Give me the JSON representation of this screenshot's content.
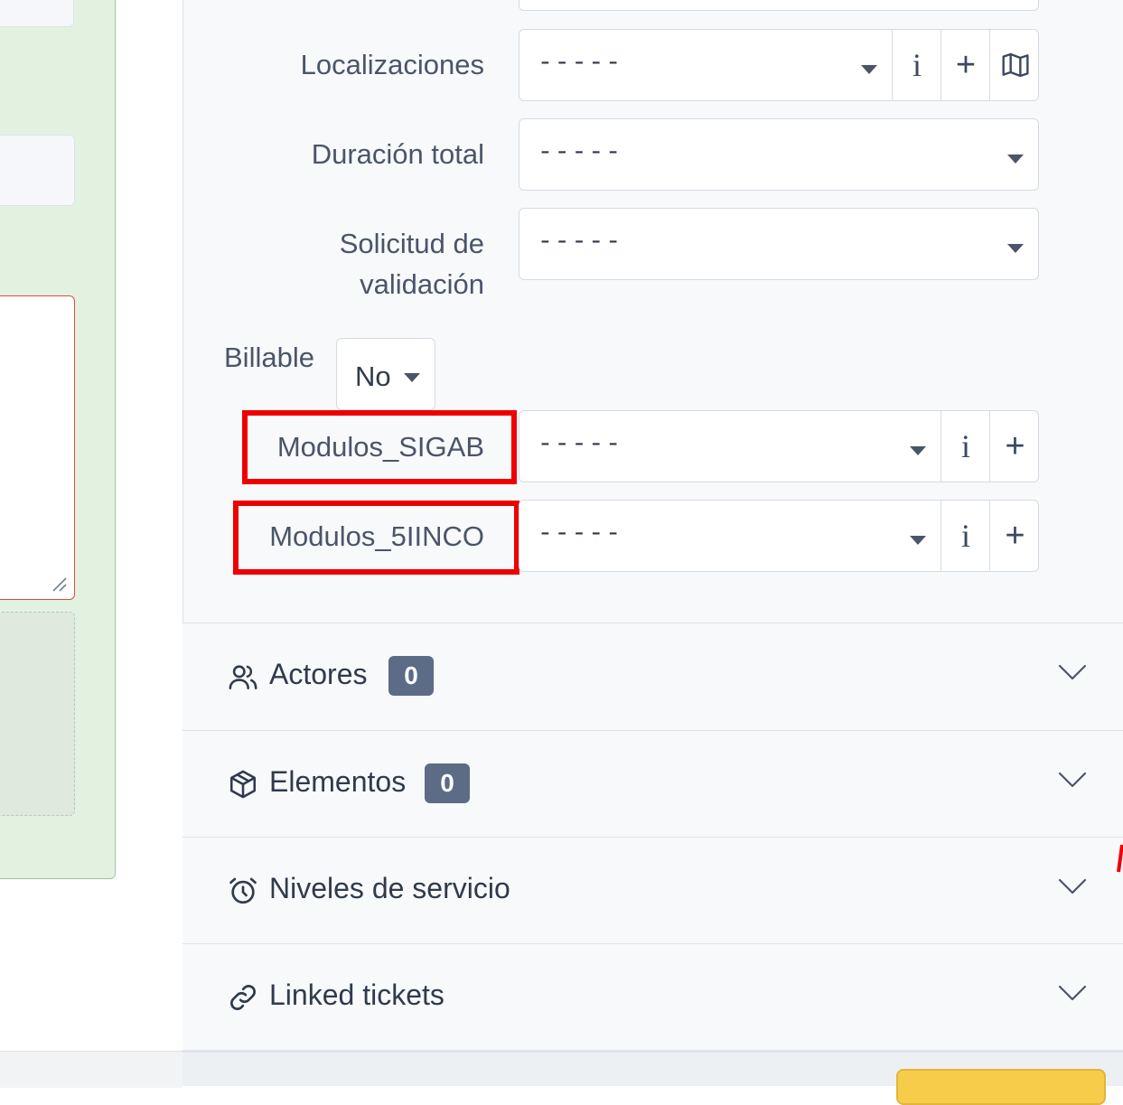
{
  "form": {
    "localizaciones": {
      "label": "Localizaciones",
      "value": "-----"
    },
    "duracion_total": {
      "label": "Duración total",
      "value": "-----"
    },
    "solicitud_validacion": {
      "label_line1": "Solicitud de",
      "label_line2": "validación",
      "value": "-----"
    },
    "billable": {
      "label": "Billable",
      "value": "No"
    },
    "modulos_sigab": {
      "label": "Modulos_SIGAB",
      "value": "-----"
    },
    "modulos_5iinco": {
      "label": "Modulos_5IINCO",
      "value": "-----"
    },
    "addon_info": "i",
    "addon_plus": "+"
  },
  "sections": {
    "actores": {
      "title": "Actores",
      "count": "0",
      "icon": "users-icon"
    },
    "elementos": {
      "title": "Elementos",
      "count": "0",
      "icon": "box-icon"
    },
    "niveles": {
      "title": "Niveles de servicio",
      "icon": "alarm-clock-icon"
    },
    "linked": {
      "title": "Linked tickets",
      "icon": "link-icon"
    }
  },
  "colors": {
    "highlight": "#ee0000",
    "badge": "#5c6b86",
    "left_panel": "#e3f2e0",
    "accent_button": "#f8cc4b"
  }
}
